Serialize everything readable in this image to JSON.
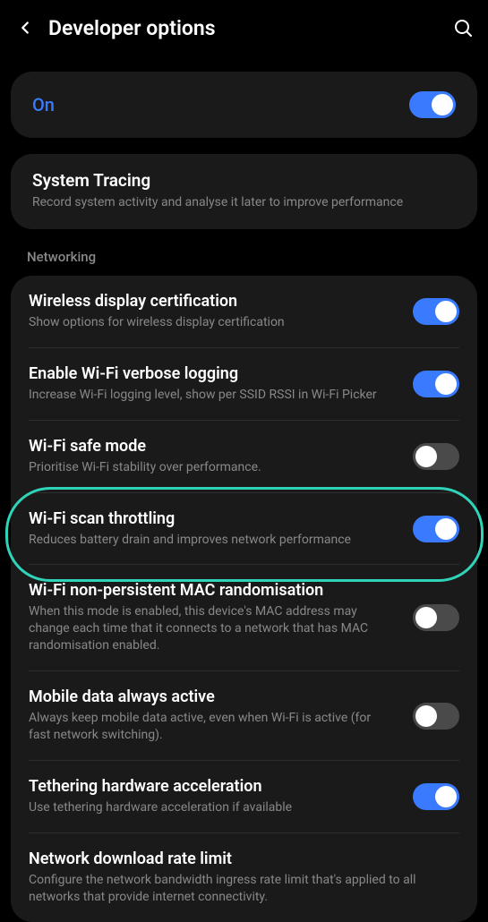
{
  "header": {
    "title": "Developer options"
  },
  "master": {
    "label": "On",
    "state": true
  },
  "tracing": {
    "title": "System Tracing",
    "desc": "Record system activity and analyse it later to improve performance"
  },
  "section": {
    "networking": "Networking"
  },
  "net": [
    {
      "title": "Wireless display certification",
      "desc": "Show options for wireless display certification",
      "on": true
    },
    {
      "title": "Enable Wi-Fi verbose logging",
      "desc": "Increase Wi-Fi logging level, show per SSID RSSI in Wi-Fi Picker",
      "on": true
    },
    {
      "title": "Wi-Fi safe mode",
      "desc": "Prioritise Wi-Fi stability over performance.",
      "on": false
    },
    {
      "title": "Wi-Fi scan throttling",
      "desc": "Reduces battery drain and improves network performance",
      "on": true
    },
    {
      "title": "Wi-Fi non-persistent MAC randomisation",
      "desc": "When this mode is enabled, this device's MAC address may change each time that it connects to a network that has MAC randomisation enabled.",
      "on": false
    },
    {
      "title": "Mobile data always active",
      "desc": "Always keep mobile data active, even when Wi-Fi is active (for fast network switching).",
      "on": false
    },
    {
      "title": "Tethering hardware acceleration",
      "desc": "Use tethering hardware acceleration if available",
      "on": true
    },
    {
      "title": "Network download rate limit",
      "desc": "Configure the network bandwidth ingress rate limit that's applied to all networks that provide internet connectivity.",
      "on": null
    }
  ]
}
